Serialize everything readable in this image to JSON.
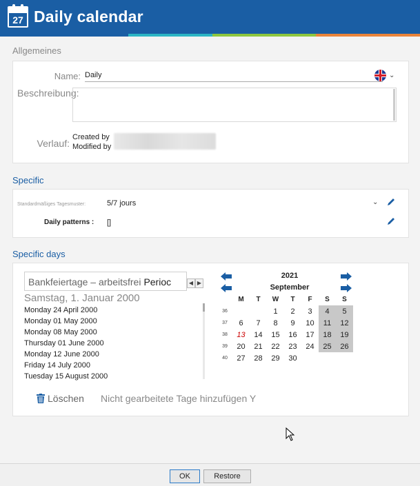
{
  "window": {
    "title": "Daily calendar",
    "icon": "calendar-icon",
    "icon_number": "27"
  },
  "colors": {
    "titlebar": "#1a5ea4",
    "stripe": [
      "#1a5ea4",
      "#2bb5c4",
      "#8dc63f",
      "#e9843a"
    ],
    "accent_text": "#1a5ea4"
  },
  "general": {
    "section_label": "Allgemeines",
    "name_label": "Name:",
    "name_value": "Daily",
    "language_icon": "uk-flag-icon",
    "description_label": "Beschreibung:",
    "history_label": "Verlauf:",
    "created_by": "Created by",
    "modified_by": "Modified by"
  },
  "specific": {
    "section_label": "Specific",
    "standard_pattern_label": "Standardmäßiges Tagesmuster:",
    "standard_pattern_value": "5/7 jours",
    "daily_patterns_label": "Daily patterns :",
    "daily_patterns_value": "[]"
  },
  "specific_days": {
    "section_label": "Specific days",
    "search_value": "Bankfeiertage – arbeitsfrei",
    "search_suffix": "Perioc",
    "selected_date": "Samstag, 1. Januar 2000",
    "items": [
      "Monday 24 April 2000",
      "Monday 01 May 2000",
      "Monday 08 May 2000",
      "Thursday 01 June 2000",
      "Monday 12 June 2000",
      "Friday 14 July 2000",
      "Tuesday 15 August 2000"
    ],
    "delete_label": "Löschen",
    "add_label": "Nicht gearbeitete Tage hinzufügen Y"
  },
  "calendar": {
    "year": "2021",
    "month": "September",
    "weekdays": [
      "M",
      "T",
      "W",
      "T",
      "F",
      "S",
      "S"
    ],
    "weeks": [
      {
        "week": "36",
        "days": [
          "",
          "",
          "1",
          "2",
          "3",
          "4",
          "5"
        ]
      },
      {
        "week": "37",
        "days": [
          "6",
          "7",
          "8",
          "9",
          "10",
          "11",
          "12"
        ]
      },
      {
        "week": "38",
        "days": [
          "13",
          "14",
          "15",
          "16",
          "17",
          "18",
          "19"
        ]
      },
      {
        "week": "39",
        "days": [
          "20",
          "21",
          "22",
          "23",
          "24",
          "25",
          "26"
        ]
      },
      {
        "week": "40",
        "days": [
          "27",
          "28",
          "29",
          "30",
          "",
          "",
          ""
        ]
      }
    ],
    "holiday_days": [
      "13"
    ]
  },
  "footer": {
    "ok_label": "OK",
    "restore_label": "Restore"
  }
}
